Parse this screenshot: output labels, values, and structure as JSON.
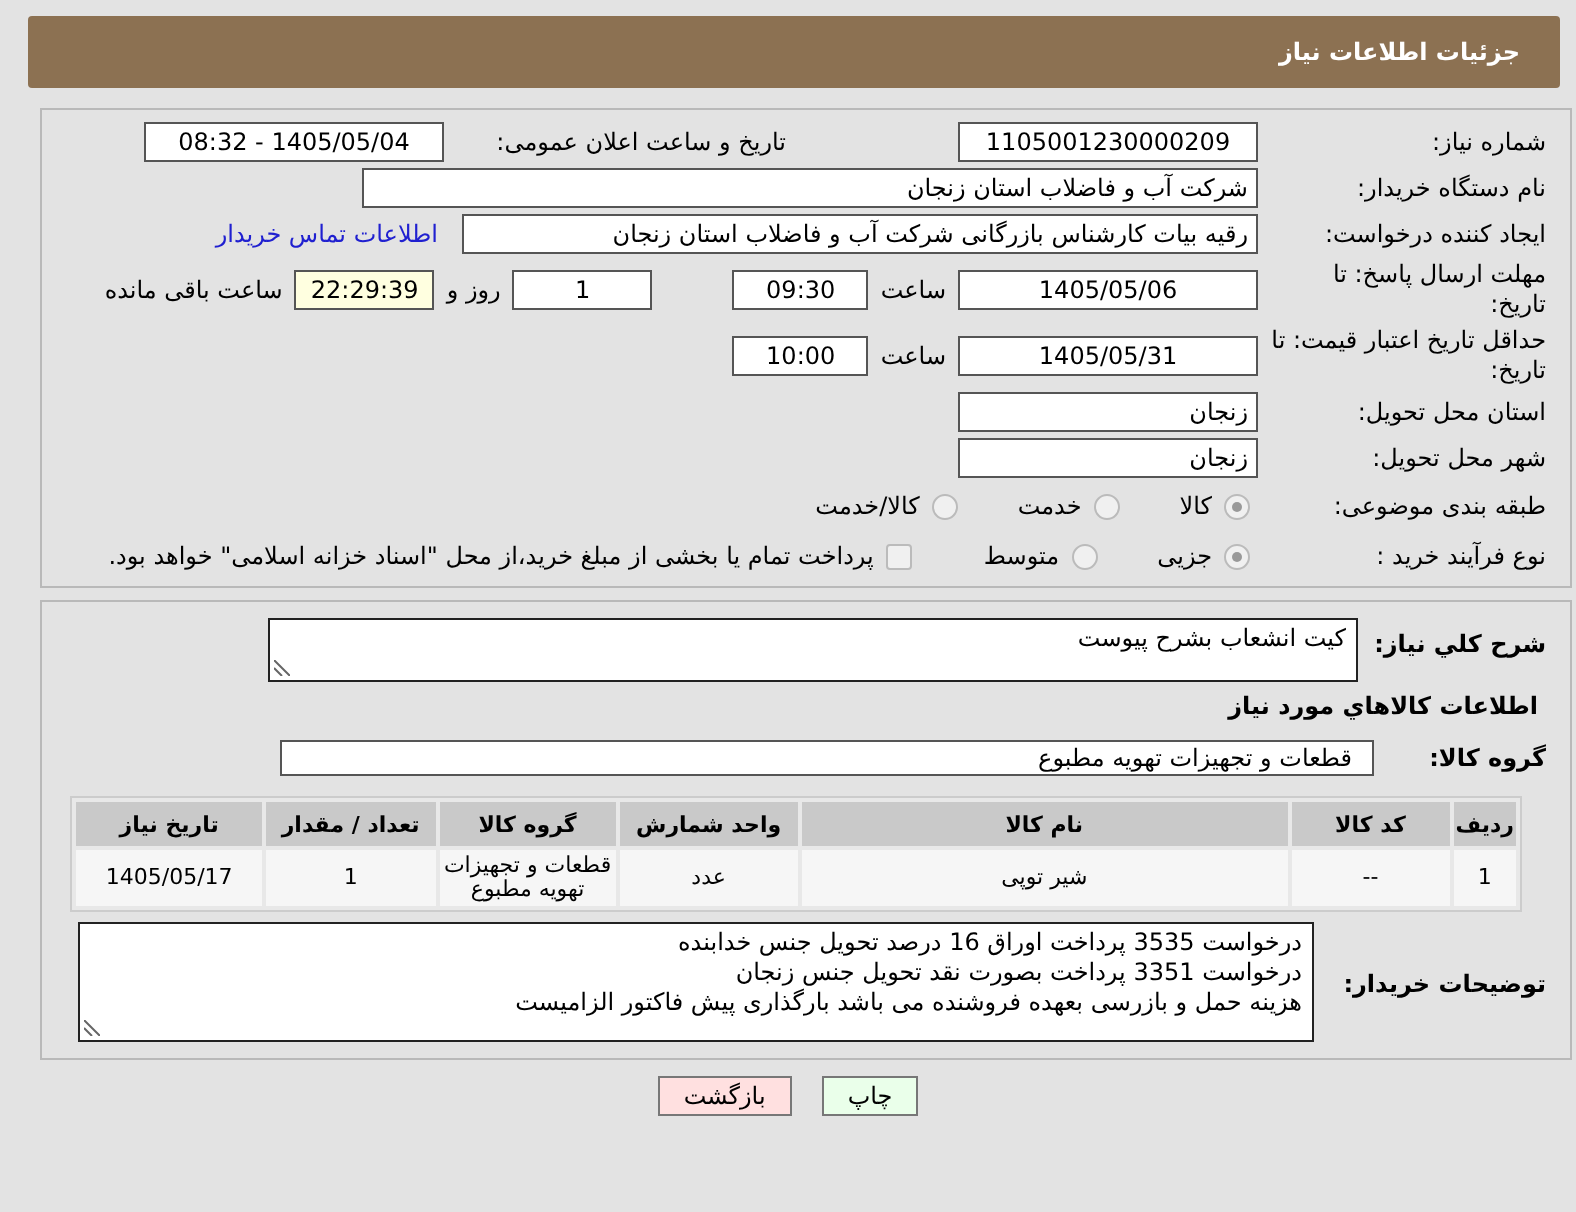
{
  "header": {
    "title": "جزئیات اطلاعات نیاز"
  },
  "need_number": {
    "label": "شماره نیاز:",
    "value": "1105001230000209"
  },
  "announce": {
    "label": "تاریخ و ساعت اعلان عمومی:",
    "value": "1405/05/04 - 08:32"
  },
  "buyer_org": {
    "label": "نام دستگاه خریدار:",
    "value": "شرکت آب و فاضلاب استان زنجان"
  },
  "requester": {
    "label": "ایجاد کننده درخواست:",
    "value": "رقیه بیات کارشناس بازرگانی شرکت آب و فاضلاب استان زنجان",
    "link": "اطلاعات تماس خریدار"
  },
  "reply_deadline": {
    "label": "مهلت ارسال پاسخ: تا تاریخ:",
    "date": "1405/05/06",
    "time_label": "ساعت",
    "time": "09:30",
    "days": "1",
    "days_label": "روز و",
    "remaining": "22:29:39",
    "remaining_label": "ساعت باقی مانده"
  },
  "price_validity": {
    "label": "حداقل تاریخ اعتبار قیمت: تا تاریخ:",
    "date": "1405/05/31",
    "time_label": "ساعت",
    "time": "10:00"
  },
  "province": {
    "label": "استان محل تحویل:",
    "value": "زنجان"
  },
  "city": {
    "label": "شهر محل تحویل:",
    "value": "زنجان"
  },
  "category": {
    "label": "طبقه بندی موضوعی:",
    "options": [
      {
        "label": "کالا",
        "selected": true
      },
      {
        "label": "خدمت",
        "selected": false
      },
      {
        "label": "کالا/خدمت",
        "selected": false
      }
    ]
  },
  "purchase_type": {
    "label": "نوع فرآیند خرید :",
    "options": [
      {
        "label": "جزیی",
        "selected": true
      },
      {
        "label": "متوسط",
        "selected": false
      }
    ],
    "payment_note": {
      "text": "پرداخت تمام یا بخشی از مبلغ خرید،از محل \"اسناد خزانه اسلامی\" خواهد بود.",
      "checked": false
    }
  },
  "description": {
    "label": "شرح کلي نياز:",
    "value": "کیت انشعاب بشرح پیوست"
  },
  "goods": {
    "title": "اطلاعات کالاهاي مورد نياز",
    "group_label": "گروه کالا:",
    "group_value": "قطعات و تجهیزات تهویه مطبوع",
    "table": {
      "columns": [
        "ردیف",
        "کد کالا",
        "نام کالا",
        "واحد شمارش",
        "گروه کالا",
        "تعداد / مقدار",
        "تاریخ نیاز"
      ],
      "rows": [
        [
          "1",
          "--",
          "شیر توپی",
          "عدد",
          "قطعات و تجهیزات تهویه مطبوع",
          "1",
          "1405/05/17"
        ]
      ]
    }
  },
  "buyer_notes": {
    "label": "توضیحات خریدار:",
    "lines": [
      "درخواست 3535 پرداخت اوراق 16 درصد تحویل جنس خدابنده",
      "درخواست 3351 پرداخت بصورت نقد تحویل جنس زنجان",
      "هزینه حمل و بازرسی بعهده فروشنده می باشد بارگذاری پیش فاکتور الزامیست"
    ]
  },
  "buttons": [
    {
      "label": "چاپ",
      "kind": "print"
    },
    {
      "label": "بازگشت",
      "kind": "back"
    }
  ]
}
